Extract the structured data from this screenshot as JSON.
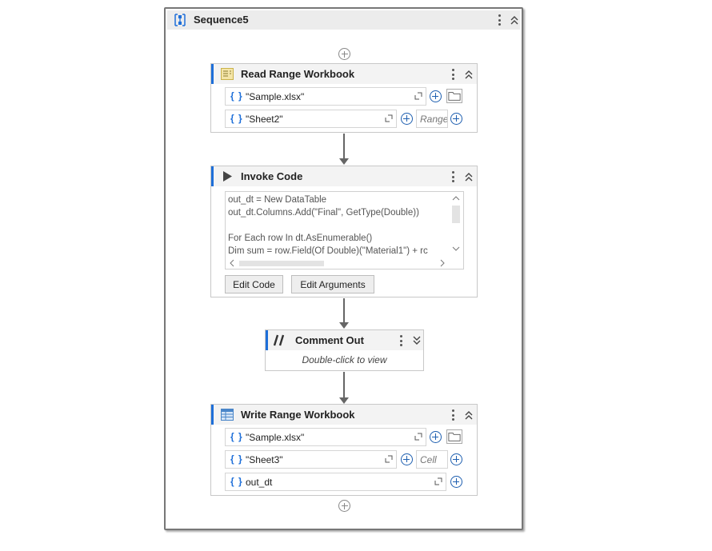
{
  "sequence": {
    "title": "Sequence5"
  },
  "read_range": {
    "title": "Read Range Workbook",
    "workbook_path": "\"Sample.xlsx\"",
    "sheet_name": "\"Sheet2\"",
    "range_placeholder": "Range"
  },
  "invoke_code": {
    "title": "Invoke Code",
    "code_lines": [
      "out_dt = New DataTable",
      "out_dt.Columns.Add(\"Final\", GetType(Double))",
      "",
      "For Each row In dt.AsEnumerable()",
      "   Dim sum = row.Field(Of Double)(\"Material1\") + rc"
    ],
    "edit_code_label": "Edit Code",
    "edit_arguments_label": "Edit Arguments"
  },
  "comment_out": {
    "title": "Comment Out",
    "hint": "Double-click to view"
  },
  "write_range": {
    "title": "Write Range Workbook",
    "workbook_path": "\"Sample.xlsx\"",
    "sheet_name": "\"Sheet3\"",
    "cell_placeholder": "Cell",
    "data_table": "out_dt"
  },
  "brace_symbol": "{ }",
  "colors": {
    "accent": "#1e6fd9",
    "header_bg": "#ececec"
  }
}
